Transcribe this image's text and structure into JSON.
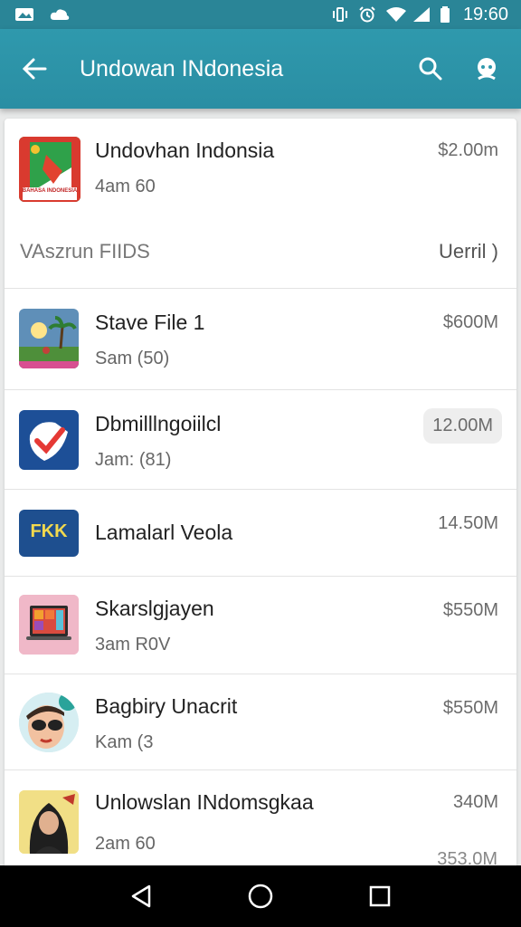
{
  "status_bar": {
    "time": "19:60",
    "icons": [
      "image-notification-icon",
      "cloud-notification-icon",
      "vibrate-icon",
      "alarm-icon",
      "wifi-icon",
      "signal-icon",
      "battery-icon"
    ]
  },
  "toolbar": {
    "title": "Undowan INdonesia",
    "icons": [
      "back-arrow-icon",
      "search-icon",
      "profile-icon"
    ]
  },
  "featured": {
    "title": "Undovhan Indonsia",
    "subtitle": "4am 60",
    "size": "$2.00m",
    "thumb_icon": "flag-app-icon",
    "thumb_caption": "BAHASA INDONESIA"
  },
  "section": {
    "title": "VAszrun FIIDS",
    "action": "Uerril )"
  },
  "items": [
    {
      "title": "Stave File 1",
      "subtitle": "Sam (50)",
      "size": "$600M",
      "thumb_icon": "beach-scene-icon"
    },
    {
      "title": "Dbmilllngoiilcl",
      "subtitle": "Jam: (81)",
      "size": "12.00M",
      "thumb_icon": "checkmark-app-icon"
    },
    {
      "title": "Lamalarl Veola",
      "subtitle": "",
      "size": "14.50M",
      "thumb_icon": "fkk-app-icon",
      "thumb_text": "FKK"
    },
    {
      "title": "Skarslgjayen",
      "subtitle": "3am R0V",
      "size": "$550M",
      "thumb_icon": "tablet-app-icon"
    },
    {
      "title": "Bagbiry Unacrit",
      "subtitle": "Kam (3",
      "size": "$550M",
      "thumb_icon": "sunglasses-face-icon"
    },
    {
      "title": "Unlowslan INdomsgkaa",
      "subtitle": "2am 60",
      "size": "340M",
      "thumb_icon": "portrait-icon"
    }
  ],
  "overflow_size": "353.0M",
  "nav_bar": {
    "icons": [
      "back-triangle-icon",
      "home-circle-icon",
      "recents-square-icon"
    ]
  },
  "colors": {
    "status_bar": "#2a8597",
    "toolbar": "#2f99ad",
    "card": "#ffffff",
    "background": "#e9eaea"
  }
}
